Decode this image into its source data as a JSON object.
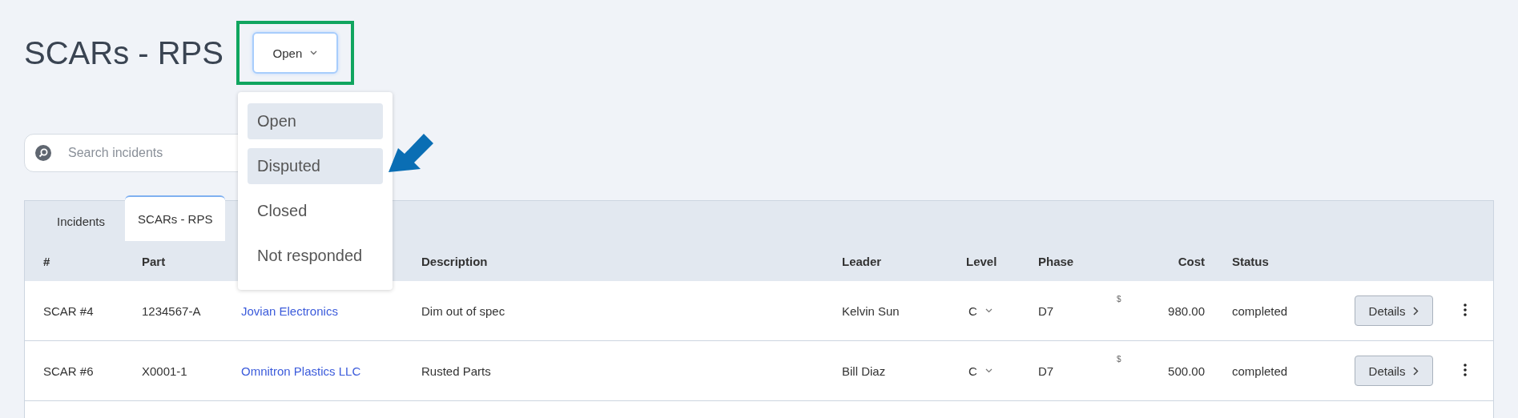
{
  "page_title": "SCARs - RPS",
  "status_dropdown": {
    "value": "Open"
  },
  "status_menu": [
    {
      "label": "Open",
      "highlighted": true
    },
    {
      "label": "Disputed",
      "highlighted": true
    },
    {
      "label": "Closed",
      "highlighted": false
    },
    {
      "label": "Not responded",
      "highlighted": false
    }
  ],
  "search": {
    "placeholder": "Search incidents"
  },
  "tabs": [
    {
      "label": "Incidents",
      "selected": false
    },
    {
      "label": "SCARs - RPS",
      "selected": true
    }
  ],
  "table": {
    "columns": [
      "#",
      "Part",
      "",
      "Description",
      "Leader",
      "Level",
      "Phase",
      "Cost",
      "Status"
    ],
    "rows": [
      {
        "number": "SCAR #4",
        "part": "1234567-A",
        "supplier": "Jovian Electronics",
        "description": "Dim out of spec",
        "leader": "Kelvin Sun",
        "level": "C",
        "phase": "D7",
        "currency": "$",
        "cost": "980.00",
        "status": "completed",
        "action": "Details"
      },
      {
        "number": "SCAR #6",
        "part": "X0001-1",
        "supplier": "Omnitron Plastics LLC",
        "description": "Rusted Parts",
        "leader": "Bill Diaz",
        "level": "C",
        "phase": "D7",
        "currency": "$",
        "cost": "500.00",
        "status": "completed",
        "action": "Details"
      }
    ]
  }
}
